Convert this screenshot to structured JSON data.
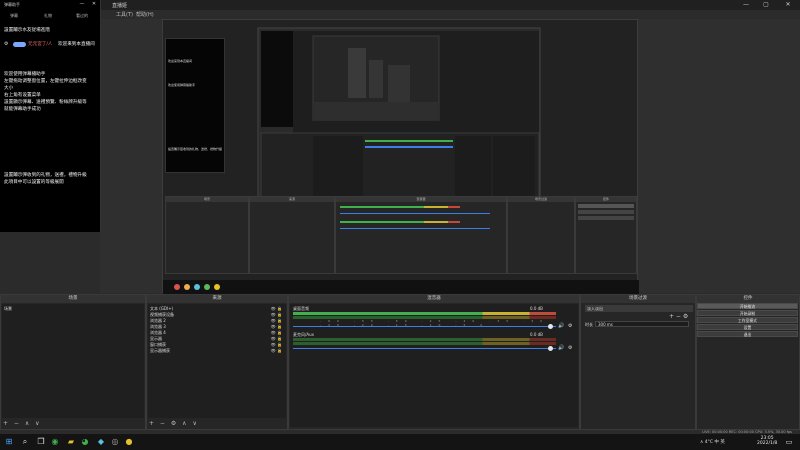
{
  "obs": {
    "title": "直播姬",
    "menu": [
      "工具(T)",
      "帮助(H)"
    ],
    "win_min": "—",
    "win_max": "▢",
    "win_close": "✕"
  },
  "chat": {
    "title": "弹幕助手",
    "tabs": [
      "弹幕",
      "礼物",
      "看过的"
    ],
    "notice_top": "設置鬮示水友從場進階",
    "badge_user": "元元宮了/人",
    "welcome_rest": "欢迎来到本直播间",
    "intro_lines": [
      "欢迎使用弹幕播助手",
      "左键拖动调整窗位置，左键拉伸边框改变",
      "大小",
      "右上角有设置菜单",
      "設置顯示彈幕、送禮預覽、粉絲牌升級等",
      "就能彈幕助手成功"
    ],
    "bottom_lines": [
      "設置鬮示彈收到的礼物，送禮，禮物升級",
      "此項目中可以設置的等級展開"
    ]
  },
  "panels": {
    "scenes": {
      "title": "场景",
      "items": [
        "场景"
      ],
      "footer": "+ − ∧ ∨"
    },
    "sources": {
      "title": "来源",
      "items": [
        "文本 (GDI+)",
        "视频捕获设备",
        "浏览器 2",
        "浏览器 3",
        "浏览器 4",
        "显示器",
        "窗口捕获",
        "显示器捕获"
      ],
      "footer": "+ − ⚙ ∧ ∨"
    },
    "mixer": {
      "title": "混音器",
      "tracks": [
        {
          "label": "桌面音频",
          "level_db": "0.0 dB"
        },
        {
          "label": "麦克风/Aux",
          "level_db": "0.0 dB"
        }
      ],
      "scale": "-60 -55 -50 -45 -40 -35 -30 -25 -20 -15 -10 -5 0"
    },
    "transitions": {
      "title": "场景过渡",
      "type": "淡入淡出",
      "duration_label": "时长",
      "duration_value": "300 ms"
    },
    "controls": {
      "title": "控件",
      "buttons": [
        "开始推流",
        "开始录制",
        "工作室模式",
        "设置",
        "退出"
      ]
    }
  },
  "status": {
    "text": "LIVE: 00:00:00   REC: 00:00:00   CPU: 3.5%, 30.00 fps"
  },
  "taskbar": {
    "time": "23:05",
    "date": "2022/1/8",
    "tray": "∧ 4°C  中  英"
  },
  "colors": {
    "meter_green": "#3fb04a",
    "meter_yellow": "#c9b232",
    "meter_red": "#c24a3a",
    "slider_blue": "#3d7ee6",
    "chat_name": "#ff6a6a"
  }
}
